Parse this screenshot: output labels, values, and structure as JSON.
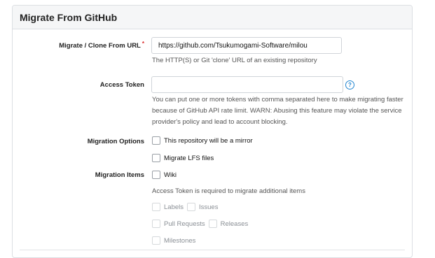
{
  "panel": {
    "title": "Migrate From GitHub"
  },
  "clone_url": {
    "label": "Migrate / Clone From URL",
    "required_mark": "*",
    "value": "https://github.com/Tsukumogami-Software/milou",
    "help": "The HTTP(S) or Git 'clone' URL of an existing repository"
  },
  "access_token": {
    "label": "Access Token",
    "value": "",
    "help_icon": "?",
    "help": "You can put one or more tokens with comma separated here to make migrating faster because of GitHub API rate limit. WARN: Abusing this feature may violate the service provider's policy and lead to account blocking."
  },
  "migration_options": {
    "label": "Migration Options",
    "mirror": {
      "label": "This repository will be a mirror",
      "checked": false
    },
    "lfs": {
      "label": "Migrate LFS files",
      "checked": false
    }
  },
  "migration_items": {
    "label": "Migration Items",
    "wiki": {
      "label": "Wiki",
      "checked": false
    },
    "token_note": "Access Token is required to migrate additional items",
    "labels": {
      "label": "Labels",
      "checked": false
    },
    "issues": {
      "label": "Issues",
      "checked": false
    },
    "pull_requests": {
      "label": "Pull Requests",
      "checked": false
    },
    "releases": {
      "label": "Releases",
      "checked": false
    },
    "milestones": {
      "label": "Milestones",
      "checked": false
    }
  }
}
